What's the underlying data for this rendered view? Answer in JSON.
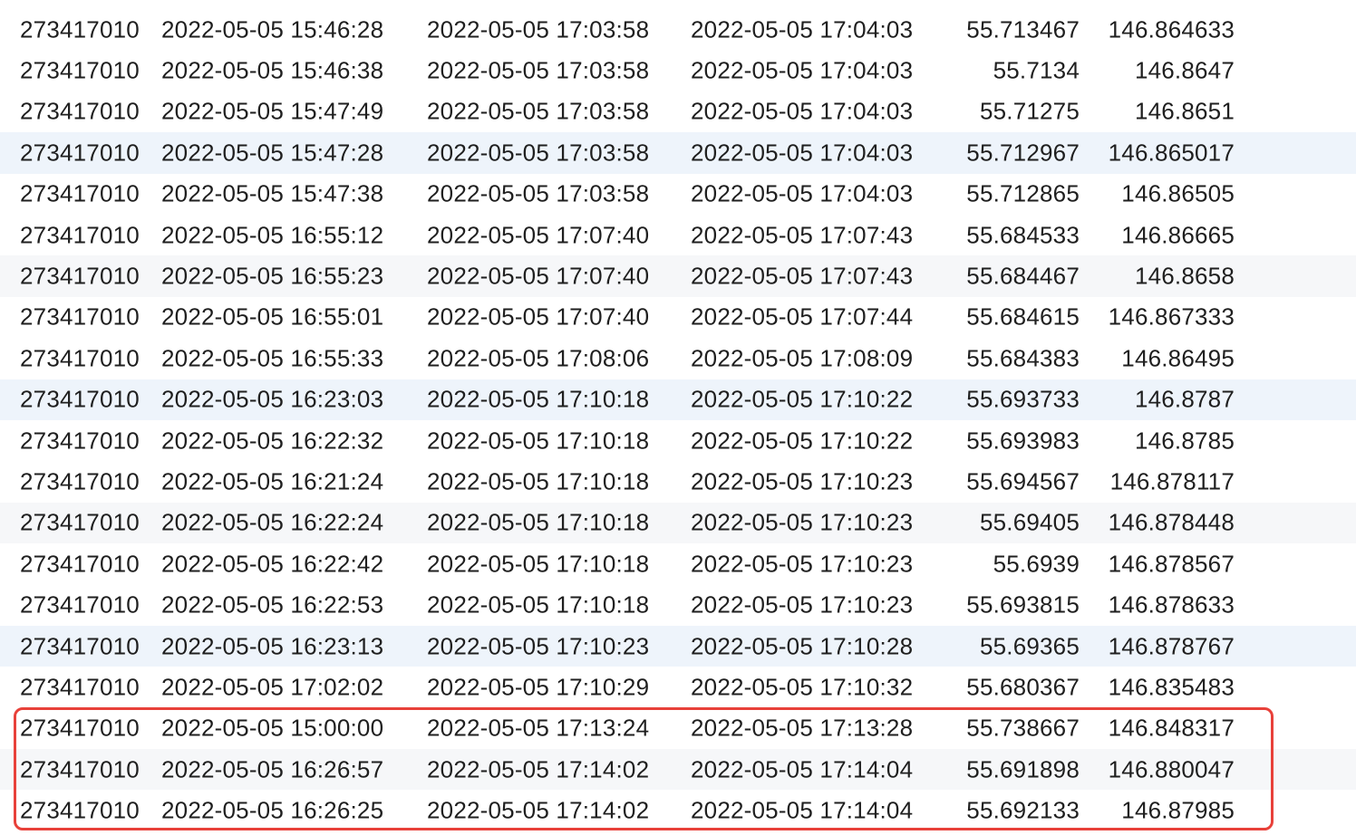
{
  "table": {
    "rows": [
      {
        "id": "273417010",
        "t1": "2022-05-05 15:46:28",
        "t2": "2022-05-05 17:03:58",
        "t3": "2022-05-05 17:04:03",
        "lat": "55.713467",
        "lon": "146.864633",
        "shade": "none"
      },
      {
        "id": "273417010",
        "t1": "2022-05-05 15:46:38",
        "t2": "2022-05-05 17:03:58",
        "t3": "2022-05-05 17:04:03",
        "lat": "55.7134",
        "lon": "146.8647",
        "shade": "none"
      },
      {
        "id": "273417010",
        "t1": "2022-05-05 15:47:49",
        "t2": "2022-05-05 17:03:58",
        "t3": "2022-05-05 17:04:03",
        "lat": "55.71275",
        "lon": "146.8651",
        "shade": "none"
      },
      {
        "id": "273417010",
        "t1": "2022-05-05 15:47:28",
        "t2": "2022-05-05 17:03:58",
        "t3": "2022-05-05 17:04:03",
        "lat": "55.712967",
        "lon": "146.865017",
        "shade": "tint"
      },
      {
        "id": "273417010",
        "t1": "2022-05-05 15:47:38",
        "t2": "2022-05-05 17:03:58",
        "t3": "2022-05-05 17:04:03",
        "lat": "55.712865",
        "lon": "146.86505",
        "shade": "none"
      },
      {
        "id": "273417010",
        "t1": "2022-05-05 16:55:12",
        "t2": "2022-05-05 17:07:40",
        "t3": "2022-05-05 17:07:43",
        "lat": "55.684533",
        "lon": "146.86665",
        "shade": "none"
      },
      {
        "id": "273417010",
        "t1": "2022-05-05 16:55:23",
        "t2": "2022-05-05 17:07:40",
        "t3": "2022-05-05 17:07:43",
        "lat": "55.684467",
        "lon": "146.8658",
        "shade": "alt"
      },
      {
        "id": "273417010",
        "t1": "2022-05-05 16:55:01",
        "t2": "2022-05-05 17:07:40",
        "t3": "2022-05-05 17:07:44",
        "lat": "55.684615",
        "lon": "146.867333",
        "shade": "none"
      },
      {
        "id": "273417010",
        "t1": "2022-05-05 16:55:33",
        "t2": "2022-05-05 17:08:06",
        "t3": "2022-05-05 17:08:09",
        "lat": "55.684383",
        "lon": "146.86495",
        "shade": "none"
      },
      {
        "id": "273417010",
        "t1": "2022-05-05 16:23:03",
        "t2": "2022-05-05 17:10:18",
        "t3": "2022-05-05 17:10:22",
        "lat": "55.693733",
        "lon": "146.8787",
        "shade": "tint"
      },
      {
        "id": "273417010",
        "t1": "2022-05-05 16:22:32",
        "t2": "2022-05-05 17:10:18",
        "t3": "2022-05-05 17:10:22",
        "lat": "55.693983",
        "lon": "146.8785",
        "shade": "none"
      },
      {
        "id": "273417010",
        "t1": "2022-05-05 16:21:24",
        "t2": "2022-05-05 17:10:18",
        "t3": "2022-05-05 17:10:23",
        "lat": "55.694567",
        "lon": "146.878117",
        "shade": "none"
      },
      {
        "id": "273417010",
        "t1": "2022-05-05 16:22:24",
        "t2": "2022-05-05 17:10:18",
        "t3": "2022-05-05 17:10:23",
        "lat": "55.69405",
        "lon": "146.878448",
        "shade": "alt"
      },
      {
        "id": "273417010",
        "t1": "2022-05-05 16:22:42",
        "t2": "2022-05-05 17:10:18",
        "t3": "2022-05-05 17:10:23",
        "lat": "55.6939",
        "lon": "146.878567",
        "shade": "none"
      },
      {
        "id": "273417010",
        "t1": "2022-05-05 16:22:53",
        "t2": "2022-05-05 17:10:18",
        "t3": "2022-05-05 17:10:23",
        "lat": "55.693815",
        "lon": "146.878633",
        "shade": "none"
      },
      {
        "id": "273417010",
        "t1": "2022-05-05 16:23:13",
        "t2": "2022-05-05 17:10:23",
        "t3": "2022-05-05 17:10:28",
        "lat": "55.69365",
        "lon": "146.878767",
        "shade": "tint"
      },
      {
        "id": "273417010",
        "t1": "2022-05-05 17:02:02",
        "t2": "2022-05-05 17:10:29",
        "t3": "2022-05-05 17:10:32",
        "lat": "55.680367",
        "lon": "146.835483",
        "shade": "none"
      },
      {
        "id": "273417010",
        "t1": "2022-05-05 15:00:00",
        "t2": "2022-05-05 17:13:24",
        "t3": "2022-05-05 17:13:28",
        "lat": "55.738667",
        "lon": "146.848317",
        "shade": "none"
      },
      {
        "id": "273417010",
        "t1": "2022-05-05 16:26:57",
        "t2": "2022-05-05 17:14:02",
        "t3": "2022-05-05 17:14:04",
        "lat": "55.691898",
        "lon": "146.880047",
        "shade": "alt"
      },
      {
        "id": "273417010",
        "t1": "2022-05-05 16:26:25",
        "t2": "2022-05-05 17:14:02",
        "t3": "2022-05-05 17:14:04",
        "lat": "55.692133",
        "lon": "146.87985",
        "shade": "none"
      }
    ]
  },
  "highlight": {
    "color": "#e8413a",
    "rows_highlighted": [
      18,
      19,
      20
    ]
  },
  "colors": {
    "row_alt": "#f6f7f9",
    "row_tint": "#eef4fb",
    "text": "#1f1f1f"
  }
}
